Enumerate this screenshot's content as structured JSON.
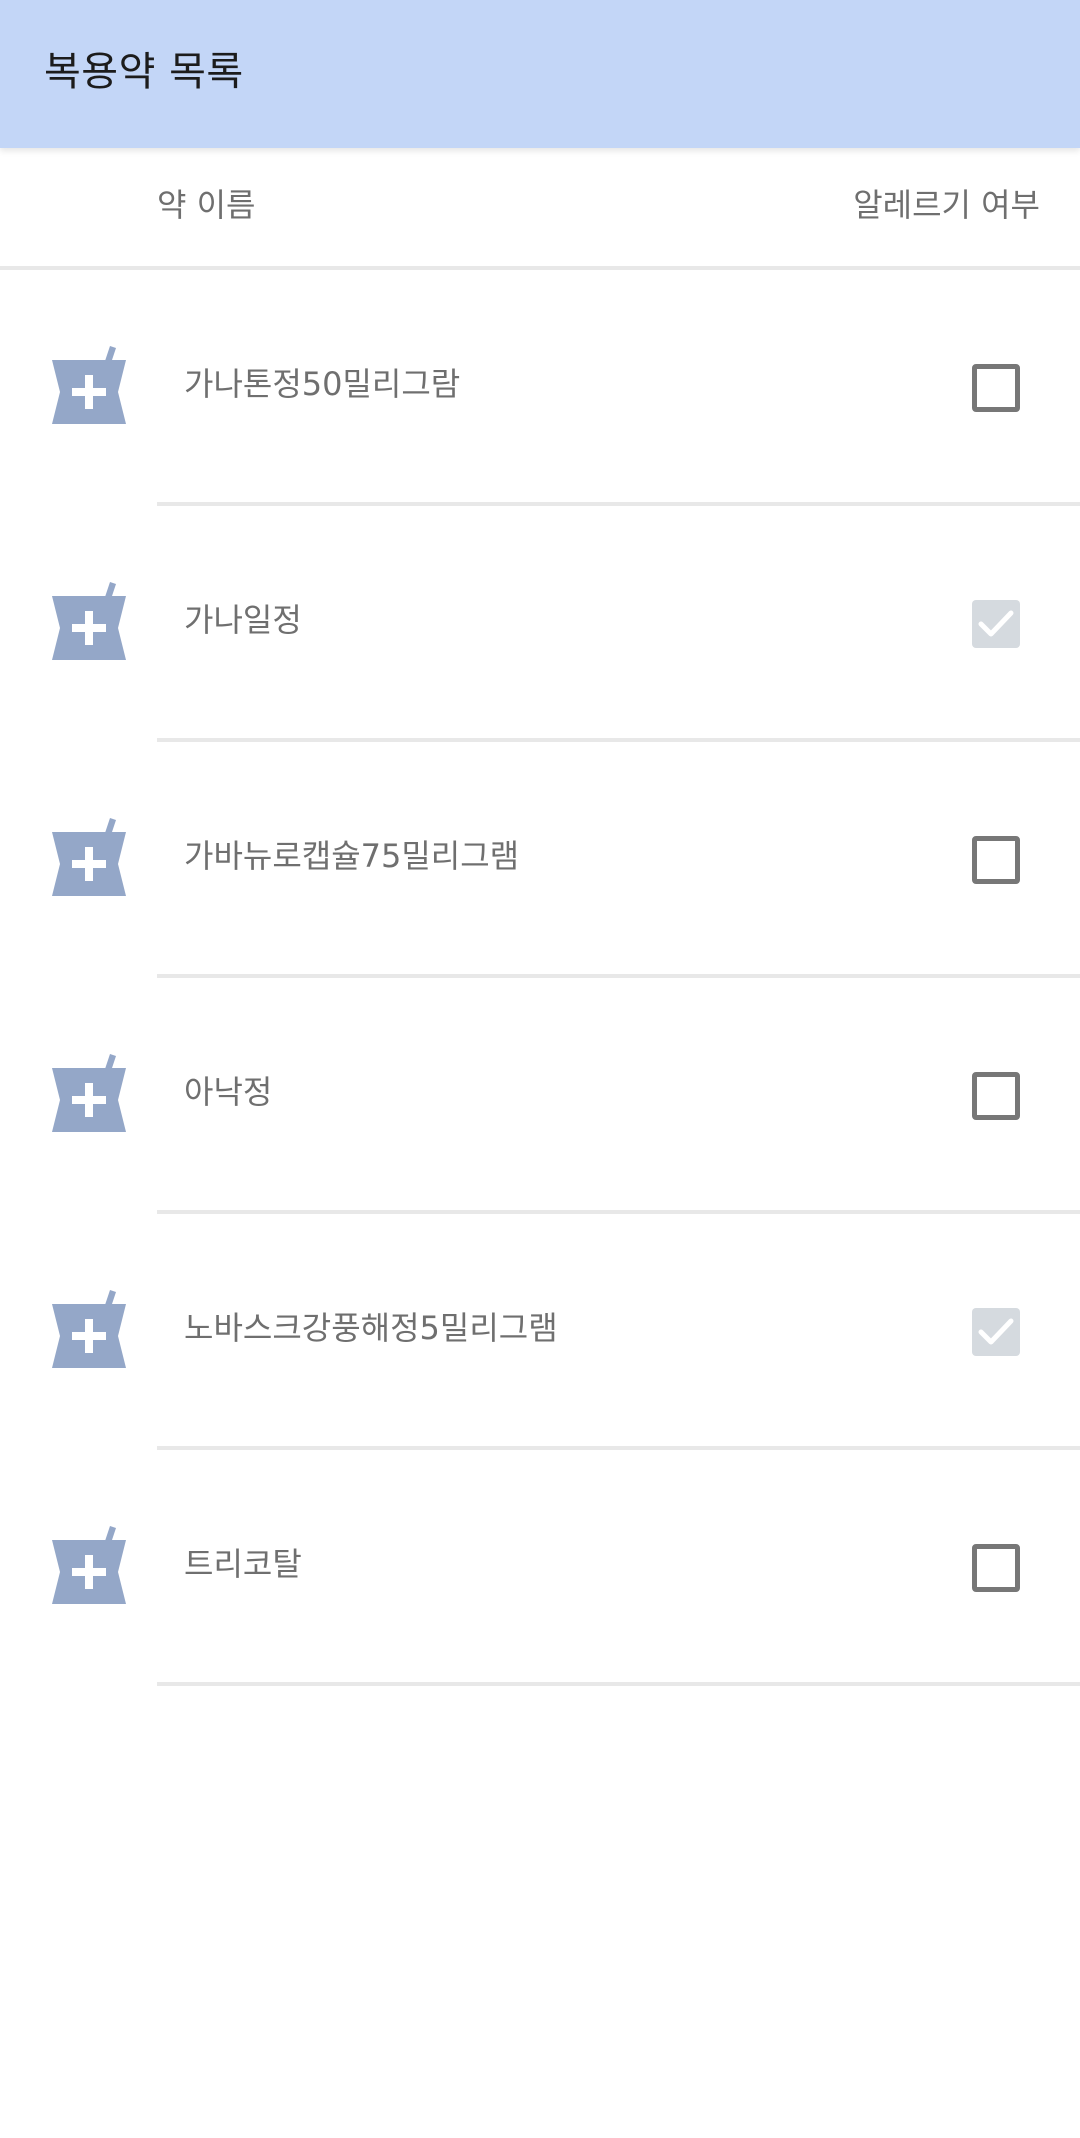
{
  "appbar": {
    "title": "복용약 목록",
    "color": "#c3d6f7"
  },
  "header": {
    "name_label": "약 이름",
    "allergy_label": "알레르기 여부"
  },
  "medicines": [
    {
      "name": "가나톤정50밀리그람",
      "allergy_checked": false,
      "icon": "mortar-pestle-plus-icon"
    },
    {
      "name": "가나일정",
      "allergy_checked": true,
      "icon": "mortar-pestle-plus-icon"
    },
    {
      "name": "가바뉴로캡슐75밀리그램",
      "allergy_checked": false,
      "icon": "mortar-pestle-plus-icon"
    },
    {
      "name": "아낙정",
      "allergy_checked": false,
      "icon": "mortar-pestle-plus-icon"
    },
    {
      "name": "노바스크강풍해정5밀리그램",
      "allergy_checked": true,
      "icon": "mortar-pestle-plus-icon"
    },
    {
      "name": "트리코탈",
      "allergy_checked": false,
      "icon": "mortar-pestle-plus-icon"
    }
  ],
  "colors": {
    "icon": "#94a7c8",
    "text": "#6f6f6f",
    "divider": "#e8e8e8",
    "checkbox_border": "#777777",
    "checkbox_checked_bg": "#d5dadf"
  }
}
